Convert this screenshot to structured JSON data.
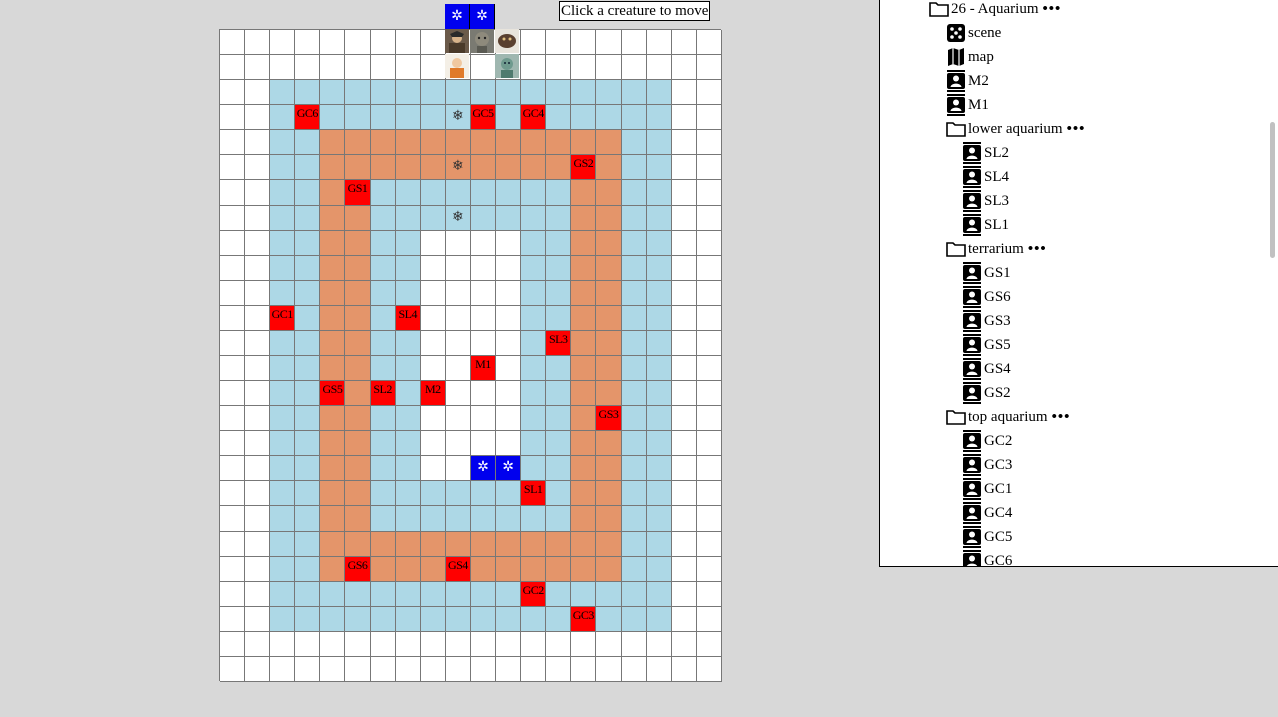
{
  "instruction": "Click a creature to move",
  "grid": {
    "cols": 20,
    "rows": 26,
    "rowsMap": [
      "WWWWWWWWWWWWWWWWWWWW",
      "WWWWWWWWWWWWWWWWWWWW",
      "WWBBBBBBBBBBBBBBBBWW",
      "WWBBBBBBBBBBBBBBBBWW",
      "WWBBSSSSSSSSSSSSBBWW",
      "WWBBSSSSSSSSSSSSBBWW",
      "WWBBSSBBBBBBBBSSBBWW",
      "WWBBSSBBBBBBBBSSBBWW",
      "WWBBSSBBWWWWBBSSBBWW",
      "WWBBSSBBWWWWBBSSBBWW",
      "WWBBSSBBWWWWBBSSBBWW",
      "WWBBSSBBWWWWBBSSBBWW",
      "WWBBSSBBWWWWBBSSBBWW",
      "WWBBSSBBWWWWBBSSBBWW",
      "WWBBSSBBWWWWBBSSBBWW",
      "WWBBSSBBWWWWBBSSBBWW",
      "WWBBSSBBWWWWBBSSBBWW",
      "WWBBSSBBWWWWBBSSBBWW",
      "WWBBSSBBBBBBBBSSBBWW",
      "WWBBSSBBBBBBBBSSBBWW",
      "WWBBSSSSSSSSSSSSBBWW",
      "WWBBSSSSSSSSSSSSBBWW",
      "WWBBBBBBBBBBBBBBBBWW",
      "WWBBBBBBBBBBBBBBBBWW",
      "WWWWWWWWWWWWWWWWWWWW",
      "WWWWWWWWWWWWWWWWWWWW"
    ],
    "tokens": [
      {
        "label": "GC6",
        "r": 3,
        "c": 3
      },
      {
        "label": "GC5",
        "r": 3,
        "c": 10
      },
      {
        "label": "GC4",
        "r": 3,
        "c": 12
      },
      {
        "label": "GS2",
        "r": 5,
        "c": 14
      },
      {
        "label": "GS1",
        "r": 6,
        "c": 5
      },
      {
        "label": "GC1",
        "r": 11,
        "c": 2
      },
      {
        "label": "SL4",
        "r": 11,
        "c": 7
      },
      {
        "label": "SL3",
        "r": 12,
        "c": 13
      },
      {
        "label": "M1",
        "r": 13,
        "c": 10
      },
      {
        "label": "GS5",
        "r": 14,
        "c": 4
      },
      {
        "label": "SL2",
        "r": 14,
        "c": 6
      },
      {
        "label": "M2",
        "r": 14,
        "c": 8
      },
      {
        "label": "GS3",
        "r": 15,
        "c": 15
      },
      {
        "label": "SL1",
        "r": 18,
        "c": 12
      },
      {
        "label": "GS6",
        "r": 21,
        "c": 5
      },
      {
        "label": "GS4",
        "r": 21,
        "c": 9
      },
      {
        "label": "GC2",
        "r": 22,
        "c": 12
      },
      {
        "label": "GC3",
        "r": 23,
        "c": 14
      }
    ],
    "blueCells": [
      {
        "r": 17,
        "c": 10,
        "glyph": "✲"
      },
      {
        "r": 17,
        "c": 11,
        "glyph": "✲"
      }
    ],
    "snowflakes": [
      {
        "r": 3,
        "c": 9,
        "glyph": "❄"
      },
      {
        "r": 5,
        "c": 9,
        "glyph": "❄"
      },
      {
        "r": 7,
        "c": 9,
        "glyph": "❄"
      }
    ],
    "colors": {
      "W": "#ffffff",
      "B": "#add8e6",
      "S": "#e4956a",
      "token": "#ff0000",
      "blue": "#0000ee"
    }
  },
  "top_strip": [
    "✲",
    "✲"
  ],
  "tree": [
    {
      "label": "26 - Aquarium",
      "icon": "folder-icon",
      "indent": 0,
      "dots": "•••"
    },
    {
      "label": "scene",
      "icon": "dice-icon",
      "indent": 1
    },
    {
      "label": "map",
      "icon": "map-icon",
      "indent": 1
    },
    {
      "label": "M2",
      "icon": "person-card-icon",
      "indent": 1
    },
    {
      "label": "M1",
      "icon": "person-card-icon",
      "indent": 1
    },
    {
      "label": "lower aquarium",
      "icon": "folder-icon",
      "indent": 1,
      "dots": "•••"
    },
    {
      "label": "SL2",
      "icon": "person-card-icon",
      "indent": 2
    },
    {
      "label": "SL4",
      "icon": "person-card-icon",
      "indent": 2
    },
    {
      "label": "SL3",
      "icon": "person-card-icon",
      "indent": 2
    },
    {
      "label": "SL1",
      "icon": "person-card-icon",
      "indent": 2
    },
    {
      "label": "terrarium",
      "icon": "folder-icon",
      "indent": 1,
      "dots": "•••"
    },
    {
      "label": "GS1",
      "icon": "person-card-icon",
      "indent": 2
    },
    {
      "label": "GS6",
      "icon": "person-card-icon",
      "indent": 2
    },
    {
      "label": "GS3",
      "icon": "person-card-icon",
      "indent": 2
    },
    {
      "label": "GS5",
      "icon": "person-card-icon",
      "indent": 2
    },
    {
      "label": "GS4",
      "icon": "person-card-icon",
      "indent": 2
    },
    {
      "label": "GS2",
      "icon": "person-card-icon",
      "indent": 2
    },
    {
      "label": "top aquarium",
      "icon": "folder-icon",
      "indent": 1,
      "dots": "•••"
    },
    {
      "label": "GC2",
      "icon": "person-card-icon",
      "indent": 2
    },
    {
      "label": "GC3",
      "icon": "person-card-icon",
      "indent": 2
    },
    {
      "label": "GC1",
      "icon": "person-card-icon",
      "indent": 2
    },
    {
      "label": "GC4",
      "icon": "person-card-icon",
      "indent": 2
    },
    {
      "label": "GC5",
      "icon": "person-card-icon",
      "indent": 2
    },
    {
      "label": "GC6",
      "icon": "person-card-icon",
      "indent": 2
    }
  ]
}
